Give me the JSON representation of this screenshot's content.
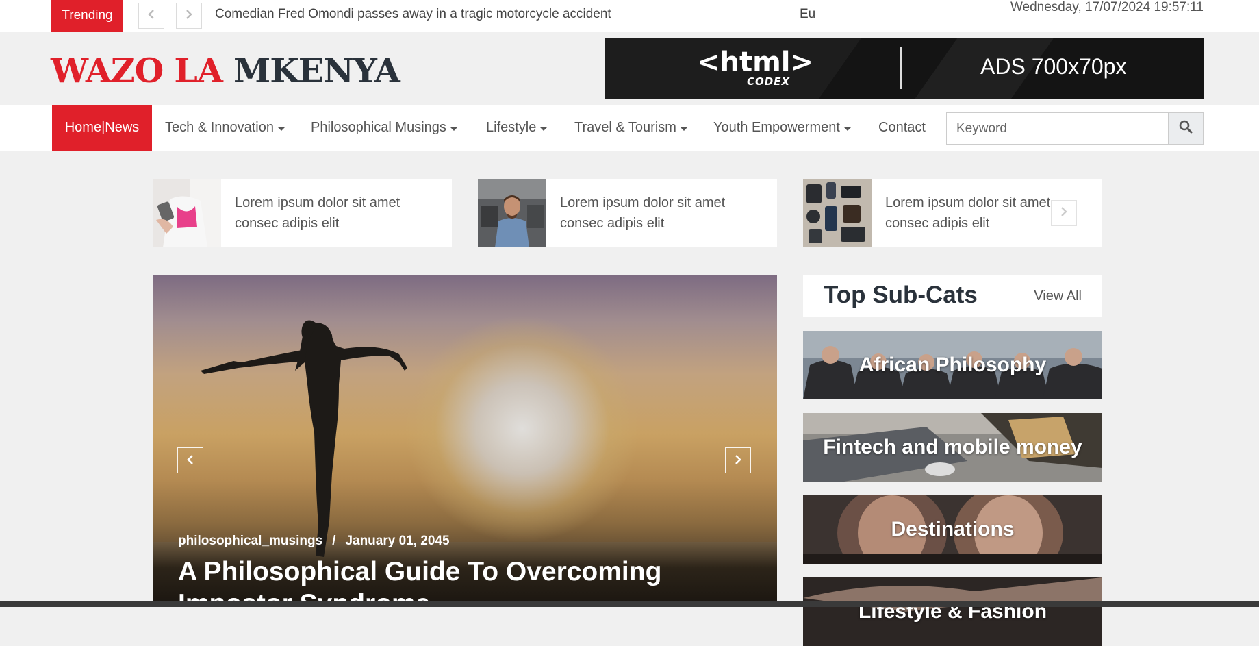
{
  "topbar": {
    "trending_label": "Trending",
    "prev_icon": "chevron-left-icon",
    "next_icon": "chevron-right-icon",
    "ticker_headline": "Comedian Fred Omondi passes away in a tragic motorcycle accident",
    "ticker_partial": "Eu",
    "datetime": "Wednesday, 17/07/2024 19:57:11"
  },
  "header": {
    "logo_part1": "WAZO LA",
    "logo_part2": "MKENYA",
    "ad": {
      "logo": "<html>",
      "logo_sub": "CODEX",
      "size_text": "ADS 700x70px"
    }
  },
  "nav": {
    "home": "Home|News",
    "items": [
      {
        "label": "Tech & Innovation",
        "dropdown": true
      },
      {
        "label": "Philosophical Musings",
        "dropdown": true
      },
      {
        "label": "Lifestyle",
        "dropdown": true
      },
      {
        "label": "Travel & Tourism",
        "dropdown": true
      },
      {
        "label": "Youth Empowerment",
        "dropdown": true
      },
      {
        "label": "Contact",
        "dropdown": false
      }
    ],
    "search": {
      "placeholder": "Keyword",
      "icon": "search-icon"
    }
  },
  "mini_cards": [
    {
      "text": "Lorem ipsum dolor sit amet consec adipis elit"
    },
    {
      "text": "Lorem ipsum dolor sit amet consec adipis elit"
    },
    {
      "text": "Lorem ipsum dolor sit amet consec adipis elit"
    }
  ],
  "hero": {
    "category": "philosophical_musings",
    "separator": "/",
    "date": "January 01, 2045",
    "title": "A Philosophical Guide To Overcoming Impostor Syndrome"
  },
  "sidebar": {
    "title": "Top Sub-Cats",
    "view_all": "View All",
    "categories": [
      {
        "label": "African Philosophy"
      },
      {
        "label": "Fintech and mobile money"
      },
      {
        "label": "Destinations"
      },
      {
        "label": "Lifestyle & Fashion"
      }
    ]
  },
  "colors": {
    "accent": "#e0202a",
    "dark_text": "#2a323b",
    "page_bg": "#f0f0f0"
  }
}
